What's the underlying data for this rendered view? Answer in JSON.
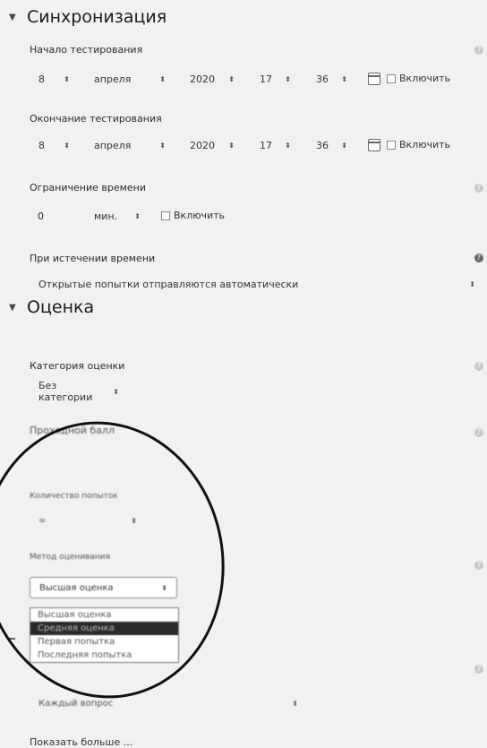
{
  "sync": {
    "title": "Синхронизация",
    "open": {
      "label": "Начало тестирования",
      "day": "8",
      "month": "апреля",
      "year": "2020",
      "hour": "17",
      "minute": "36",
      "enable": "Включить"
    },
    "close": {
      "label": "Окончание тестирования",
      "day": "8",
      "month": "апреля",
      "year": "2020",
      "hour": "17",
      "minute": "36",
      "enable": "Включить"
    },
    "timelimit": {
      "label": "Ограничение времени",
      "value": "0",
      "unit": "мин.",
      "enable": "Включить"
    },
    "expiry": {
      "label": "При истечении времени",
      "value": "Открытые попытки отправляются автоматически"
    }
  },
  "grade": {
    "title": "Оценка",
    "category": {
      "label": "Категория оценки",
      "value": "Без категории"
    },
    "pass": {
      "label": "Проходной балл"
    },
    "attempts": {
      "label": "Количество попыток",
      "value": "∞"
    },
    "method": {
      "label": "Метод оценивания",
      "value": "Высшая оценка",
      "options": [
        "Высшая оценка",
        "Средняя оценка",
        "Первая попытка",
        "Последняя попытка"
      ]
    },
    "layout": {
      "value": "Каждый вопрос"
    },
    "show_more": "Показать больше ..."
  }
}
